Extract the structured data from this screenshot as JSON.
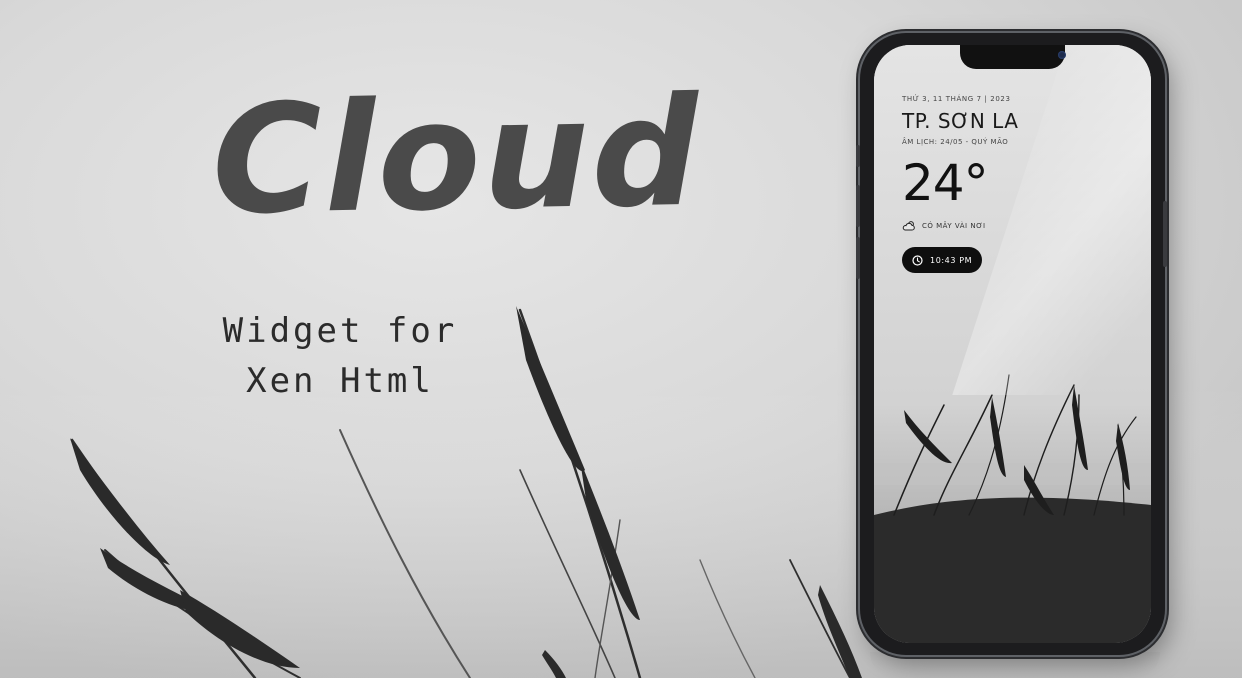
{
  "hero": {
    "title": "Cloud",
    "subtitle_line1": "Widget for",
    "subtitle_line2": "Xen Html"
  },
  "widget": {
    "date": "THỨ 3, 11 THÁNG 7 | 2023",
    "city": "TP. SƠN LA",
    "lunar": "ÂM LỊCH: 24/05 - QUÝ MÃO",
    "temperature": "24°",
    "condition": "CÓ MÂY VÀI NƠI",
    "condition_icon": "cloud-sun-icon",
    "time": "10:43 PM",
    "time_icon": "clock-icon"
  },
  "colors": {
    "background": "#d6d6d6",
    "title": "#4a4a4a",
    "phone_frame": "#1c1c1e",
    "pill": "#0e0e0e"
  }
}
